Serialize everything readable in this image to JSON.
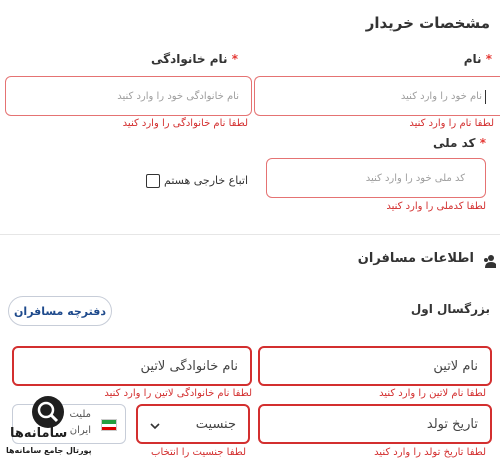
{
  "buyer": {
    "title": "مشخصات خریدار",
    "first_name_label": "نام",
    "first_name_placeholder": "نام خود را وارد کنید",
    "first_name_error": "لطفا نام را وارد کنید",
    "last_name_label": "نام خانوادگی",
    "last_name_placeholder": "نام خانوادگی خود را وارد کنید",
    "last_name_error": "لطفا نام خانوادگی را وارد کنید",
    "national_code_label": "کد ملی",
    "national_code_placeholder": "کد ملی خود را وارد کنید",
    "national_code_error": "لطفا کدملی را وارد کنید",
    "foreign_label": "اتباع خارجی هستم",
    "required_mark": "*"
  },
  "passengers": {
    "title": "اطلاعات مسافران",
    "passenger_book_button": "دفترچه مسافران",
    "adult_label": "بزرگسال اول",
    "latin_first_placeholder": "نام لاتین",
    "latin_first_error": "لطفا نام لاتین را وارد کنید",
    "latin_last_placeholder": "نام خانوادگی لاتین",
    "latin_last_error": "لطفا نام خانوادگی لاتین را وارد کنید",
    "birth_date_placeholder": "تاریخ تولد",
    "birth_date_error": "لطفا تاریخ تولد را وارد کنید",
    "gender_placeholder": "جنسیت",
    "gender_error": "لطفا جنسیت را انتخاب",
    "nationality_label": "ملیت",
    "nationality_value": "ایران"
  },
  "watermark": {
    "brand": "سامانه‌ها",
    "tagline": "پورتال جامع سامانه‌ها"
  },
  "colors": {
    "error": "#d32f2f",
    "border_error": "#e57373",
    "accent": "#1e4a8c"
  }
}
